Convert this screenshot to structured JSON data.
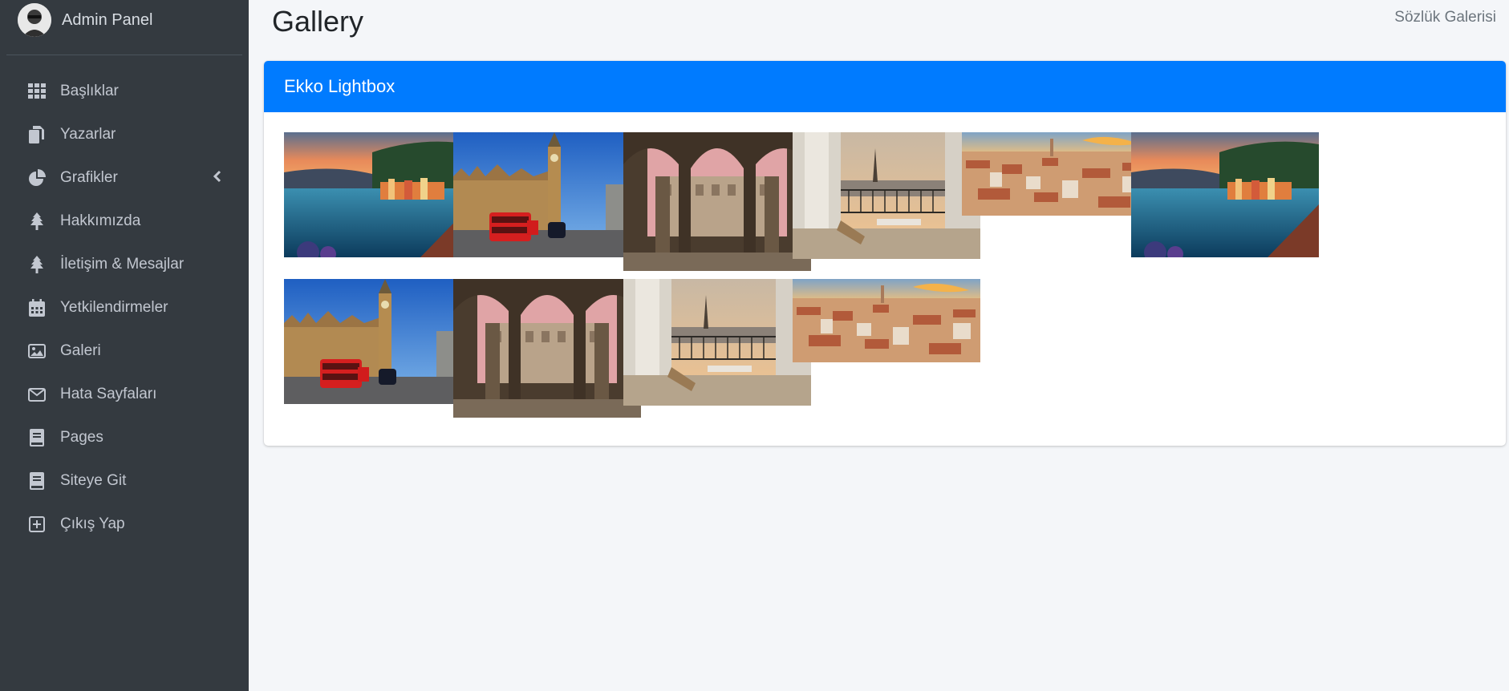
{
  "brand": {
    "title": "Admin Panel"
  },
  "sidebar": {
    "items": [
      {
        "label": "Başlıklar",
        "icon": "grid-icon"
      },
      {
        "label": "Yazarlar",
        "icon": "copy-icon"
      },
      {
        "label": "Grafikler",
        "icon": "chart-pie-icon",
        "has_chevron": true
      },
      {
        "label": "Hakkımızda",
        "icon": "tree-icon"
      },
      {
        "label": "İletişim & Mesajlar",
        "icon": "tree-icon"
      },
      {
        "label": "Yetkilendirmeler",
        "icon": "calendar-icon"
      },
      {
        "label": "Galeri",
        "icon": "image-icon"
      },
      {
        "label": "Hata Sayfaları",
        "icon": "envelope-icon"
      },
      {
        "label": "Pages",
        "icon": "book-icon"
      },
      {
        "label": "Siteye Git",
        "icon": "book-icon"
      },
      {
        "label": "Çıkış Yap",
        "icon": "plus-square-icon"
      }
    ]
  },
  "header": {
    "title": "Gallery",
    "breadcrumb": "Sözlük Galerisi"
  },
  "card": {
    "title": "Ekko Lightbox"
  },
  "gallery": {
    "images": [
      {
        "subject": "lake-village"
      },
      {
        "subject": "big-ben"
      },
      {
        "subject": "arcade-courtyard"
      },
      {
        "subject": "paris-balcony"
      },
      {
        "subject": "city-rooftops"
      },
      {
        "subject": "lake-village"
      },
      {
        "subject": "big-ben"
      },
      {
        "subject": "arcade-courtyard"
      },
      {
        "subject": "paris-balcony"
      },
      {
        "subject": "city-rooftops"
      }
    ]
  },
  "colors": {
    "sidebar": "#343a40",
    "accent": "#007bff",
    "background": "#f4f6f9"
  }
}
